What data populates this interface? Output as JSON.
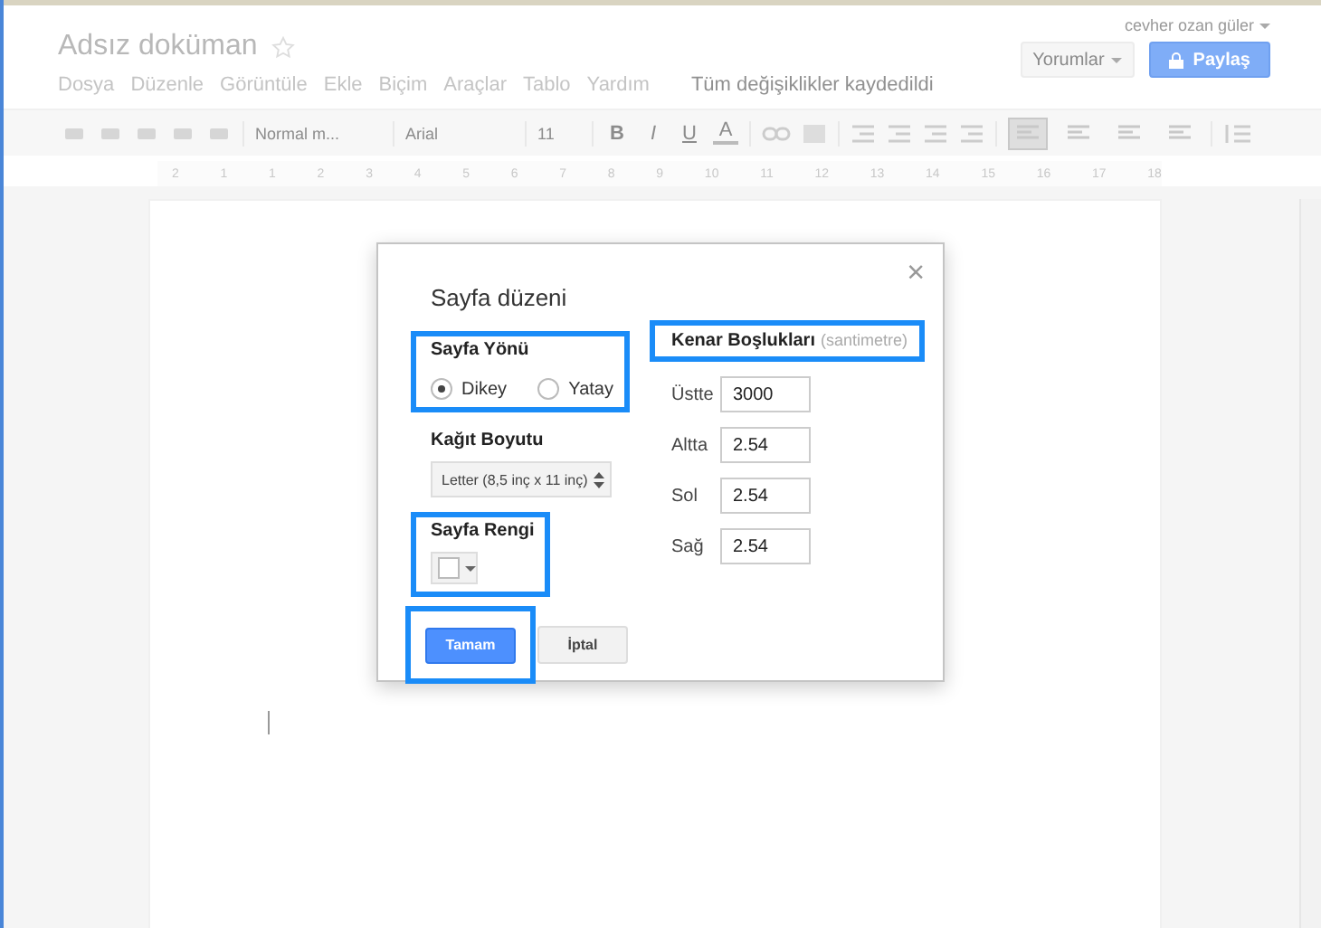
{
  "user": "cevher ozan güler",
  "doc_title": "Adsız doküman",
  "menu": [
    "Dosya",
    "Düzenle",
    "Görüntüle",
    "Ekle",
    "Biçim",
    "Araçlar",
    "Tablo",
    "Yardım"
  ],
  "save_status": "Tüm değişiklikler kaydedildi",
  "comments_button": "Yorumlar",
  "share_button": "Paylaş",
  "toolbar": {
    "style": "Normal m...",
    "font": "Arial",
    "size": "11",
    "format_buttons": [
      "B",
      "I",
      "U",
      "A"
    ],
    "alignments": [
      {
        "selected": true
      },
      {
        "selected": false
      },
      {
        "selected": false
      },
      {
        "selected": false
      }
    ]
  },
  "ruler": [
    "2",
    "1",
    "1",
    "2",
    "3",
    "4",
    "5",
    "6",
    "7",
    "8",
    "9",
    "10",
    "11",
    "12",
    "13",
    "14",
    "15",
    "16",
    "17",
    "18"
  ],
  "dialog": {
    "title": "Sayfa düzeni",
    "close": "×",
    "orientation": {
      "label": "Sayfa Yönü",
      "highlighted": true,
      "options": [
        {
          "label": "Dikey",
          "selected": true
        },
        {
          "label": "Yatay",
          "selected": false
        }
      ]
    },
    "paper_size": {
      "label": "Kağıt Boyutu",
      "value": "Letter (8,5 inç x 11 inç)"
    },
    "page_color": {
      "label": "Sayfa Rengi",
      "highlighted": true
    },
    "margins": {
      "label": "Kenar Boşlukları",
      "unit": "(santimetre)",
      "highlighted": true,
      "fields": [
        {
          "label": "Üstte",
          "value": "3000"
        },
        {
          "label": "Altta",
          "value": "2.54"
        },
        {
          "label": "Sol",
          "value": "2.54"
        },
        {
          "label": "Sağ",
          "value": "2.54"
        }
      ]
    },
    "ok_button": {
      "label": "Tamam",
      "highlighted": true
    },
    "cancel_button": "İptal"
  }
}
